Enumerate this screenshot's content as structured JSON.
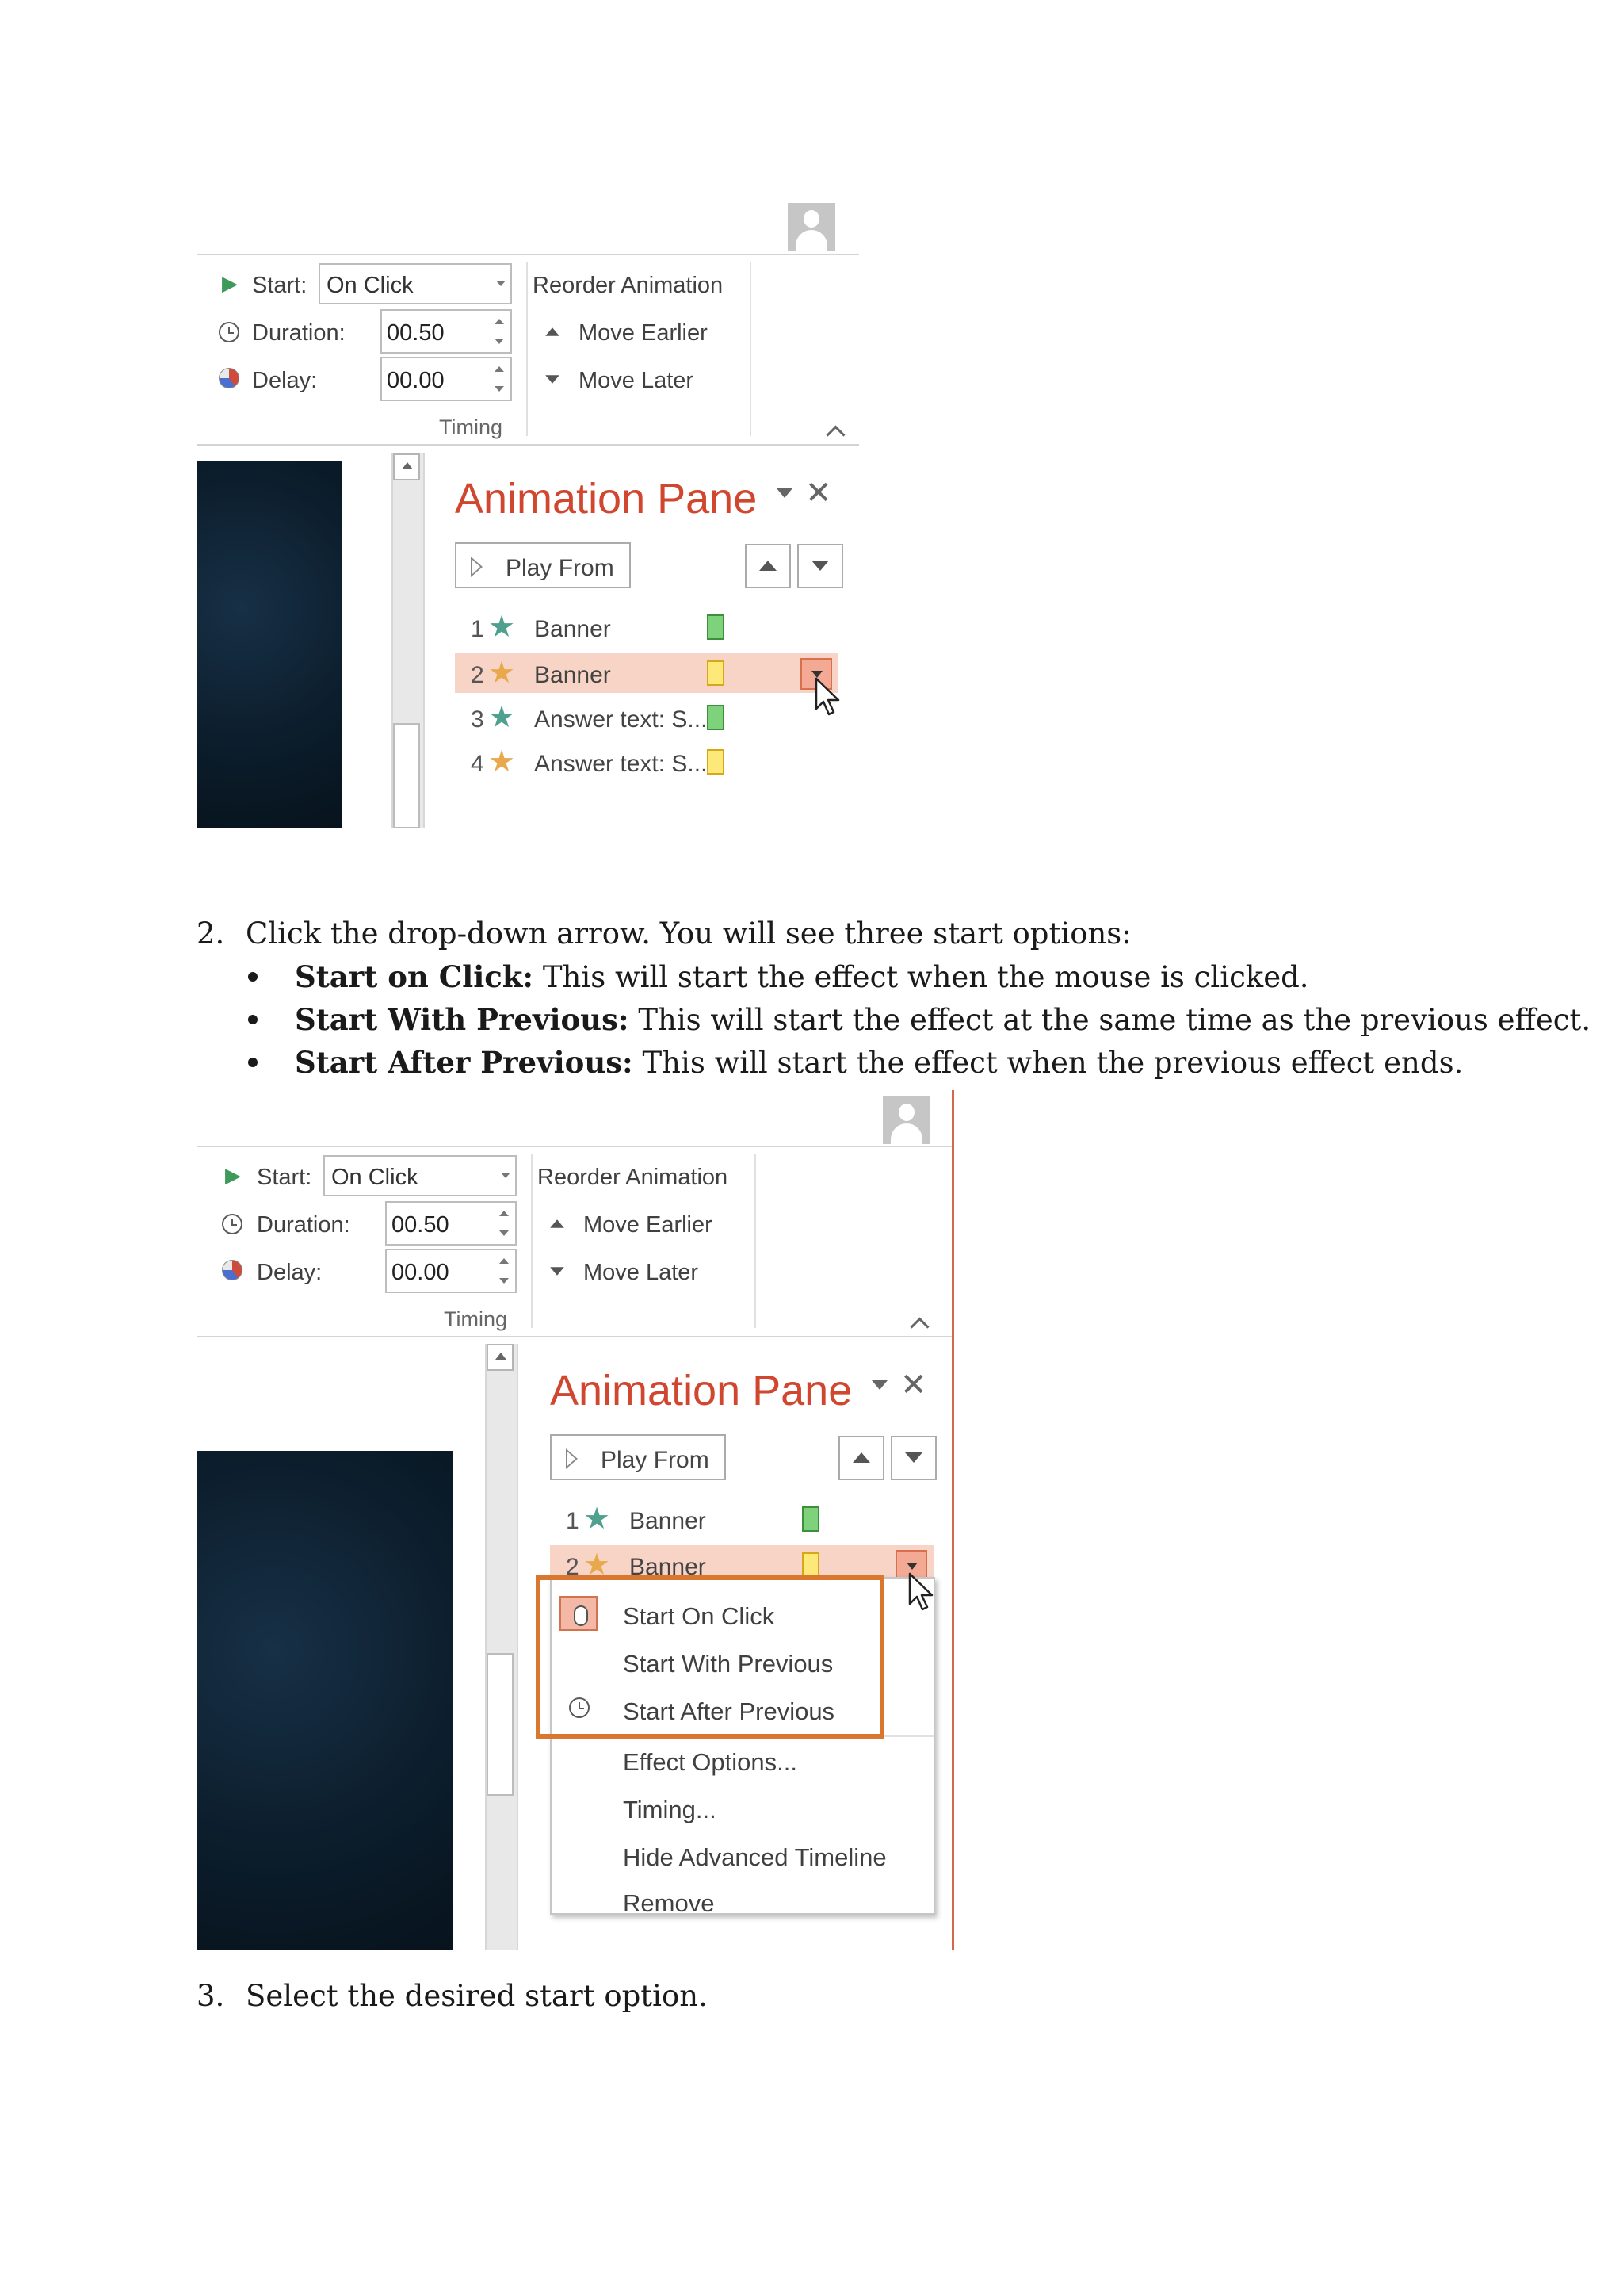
{
  "ribbon": {
    "start_label": "Start:",
    "start_value": "On Click",
    "duration_label": "Duration:",
    "duration_value": "00.50",
    "delay_label": "Delay:",
    "delay_value": "00.00",
    "reorder_label": "Reorder Animation",
    "move_earlier": "Move Earlier",
    "move_later": "Move Later",
    "group_label": "Timing"
  },
  "pane": {
    "title": "Animation Pane",
    "close_glyph": "✕",
    "play_from": "Play From",
    "rows": [
      {
        "num": "1",
        "name": "Banner",
        "star_color": "#4fa08f",
        "swatch": "green"
      },
      {
        "num": "2",
        "name": "Banner",
        "star_color": "#e8a94c",
        "swatch": "yellow"
      },
      {
        "num": "3",
        "name": "Answer text: S...",
        "star_color": "#4fa08f",
        "swatch": "green"
      },
      {
        "num": "4",
        "name": "Answer text: S...",
        "star_color": "#e8a94c",
        "swatch": "yellow"
      }
    ]
  },
  "menu": {
    "start_on_click": "Start On Click",
    "start_with_previous": "Start With Previous",
    "start_after_previous": "Start After Previous",
    "effect_options": "Effect Options...",
    "timing": "Timing...",
    "hide_timeline": "Hide Advanced Timeline",
    "remove": "Remove"
  },
  "document": {
    "step2_num": "2.",
    "step2_text": "Click the drop-down arrow. You will see three start options:",
    "bullets": [
      {
        "term": "Start on Click:",
        "desc": "This will start the effect when the mouse is clicked."
      },
      {
        "term": "Start With Previous:",
        "desc": "This will start the effect at the same time as the previous effect."
      },
      {
        "term": "Start After Previous:",
        "desc": "This will start the effect when the previous effect ends."
      }
    ],
    "step3_num": "3.",
    "step3_text": "Select the desired start option."
  },
  "colors": {
    "pane_title": "#d1462f",
    "selection": "#f8d4c6",
    "highlight_box": "#d9772e"
  }
}
